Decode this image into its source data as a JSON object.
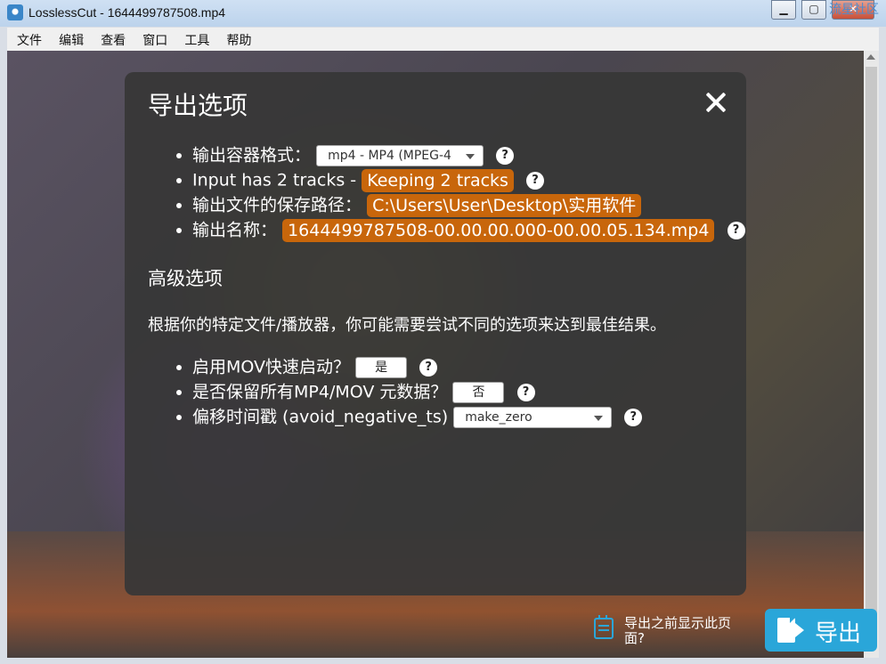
{
  "window": {
    "title": "LosslessCut - 1644499787508.mp4",
    "min_icon": "minimize-icon",
    "max_icon": "maximize-icon",
    "close_icon": "close-icon",
    "watermark": "流星社区"
  },
  "menu": [
    "文件",
    "编辑",
    "查看",
    "窗口",
    "工具",
    "帮助"
  ],
  "dialog": {
    "title": "导出选项",
    "options": {
      "container_label": "输出容器格式：",
      "container_value": "mp4 - MP4 (MPEG-4",
      "tracks_label": "Input has 2 tracks - ",
      "tracks_value": "Keeping 2 tracks",
      "path_label": "输出文件的保存路径：",
      "path_value": "C:\\Users\\User\\Desktop\\实用软件",
      "name_label": "输出名称：",
      "name_value": "1644499787508-00.00.00.000-00.00.05.134.mp4"
    },
    "advanced": {
      "title": "高级选项",
      "description": "根据你的特定文件/播放器，你可能需要尝试不同的选项来达到最佳结果。",
      "movflags_label": "启用MOV快速启动？",
      "movflags_value": "是",
      "metadata_label": "是否保留所有MP4/MOV 元数据？",
      "metadata_value": "否",
      "avoid_negative_label": "偏移时间戳 (avoid_negative_ts)",
      "avoid_negative_value": "make_zero"
    },
    "help_mark": "?"
  },
  "footer": {
    "show_dialog_label": "导出之前显示此页面?",
    "export_label": "导出"
  },
  "colors": {
    "accent": "#c8660b",
    "primary": "#2aa6d9"
  }
}
